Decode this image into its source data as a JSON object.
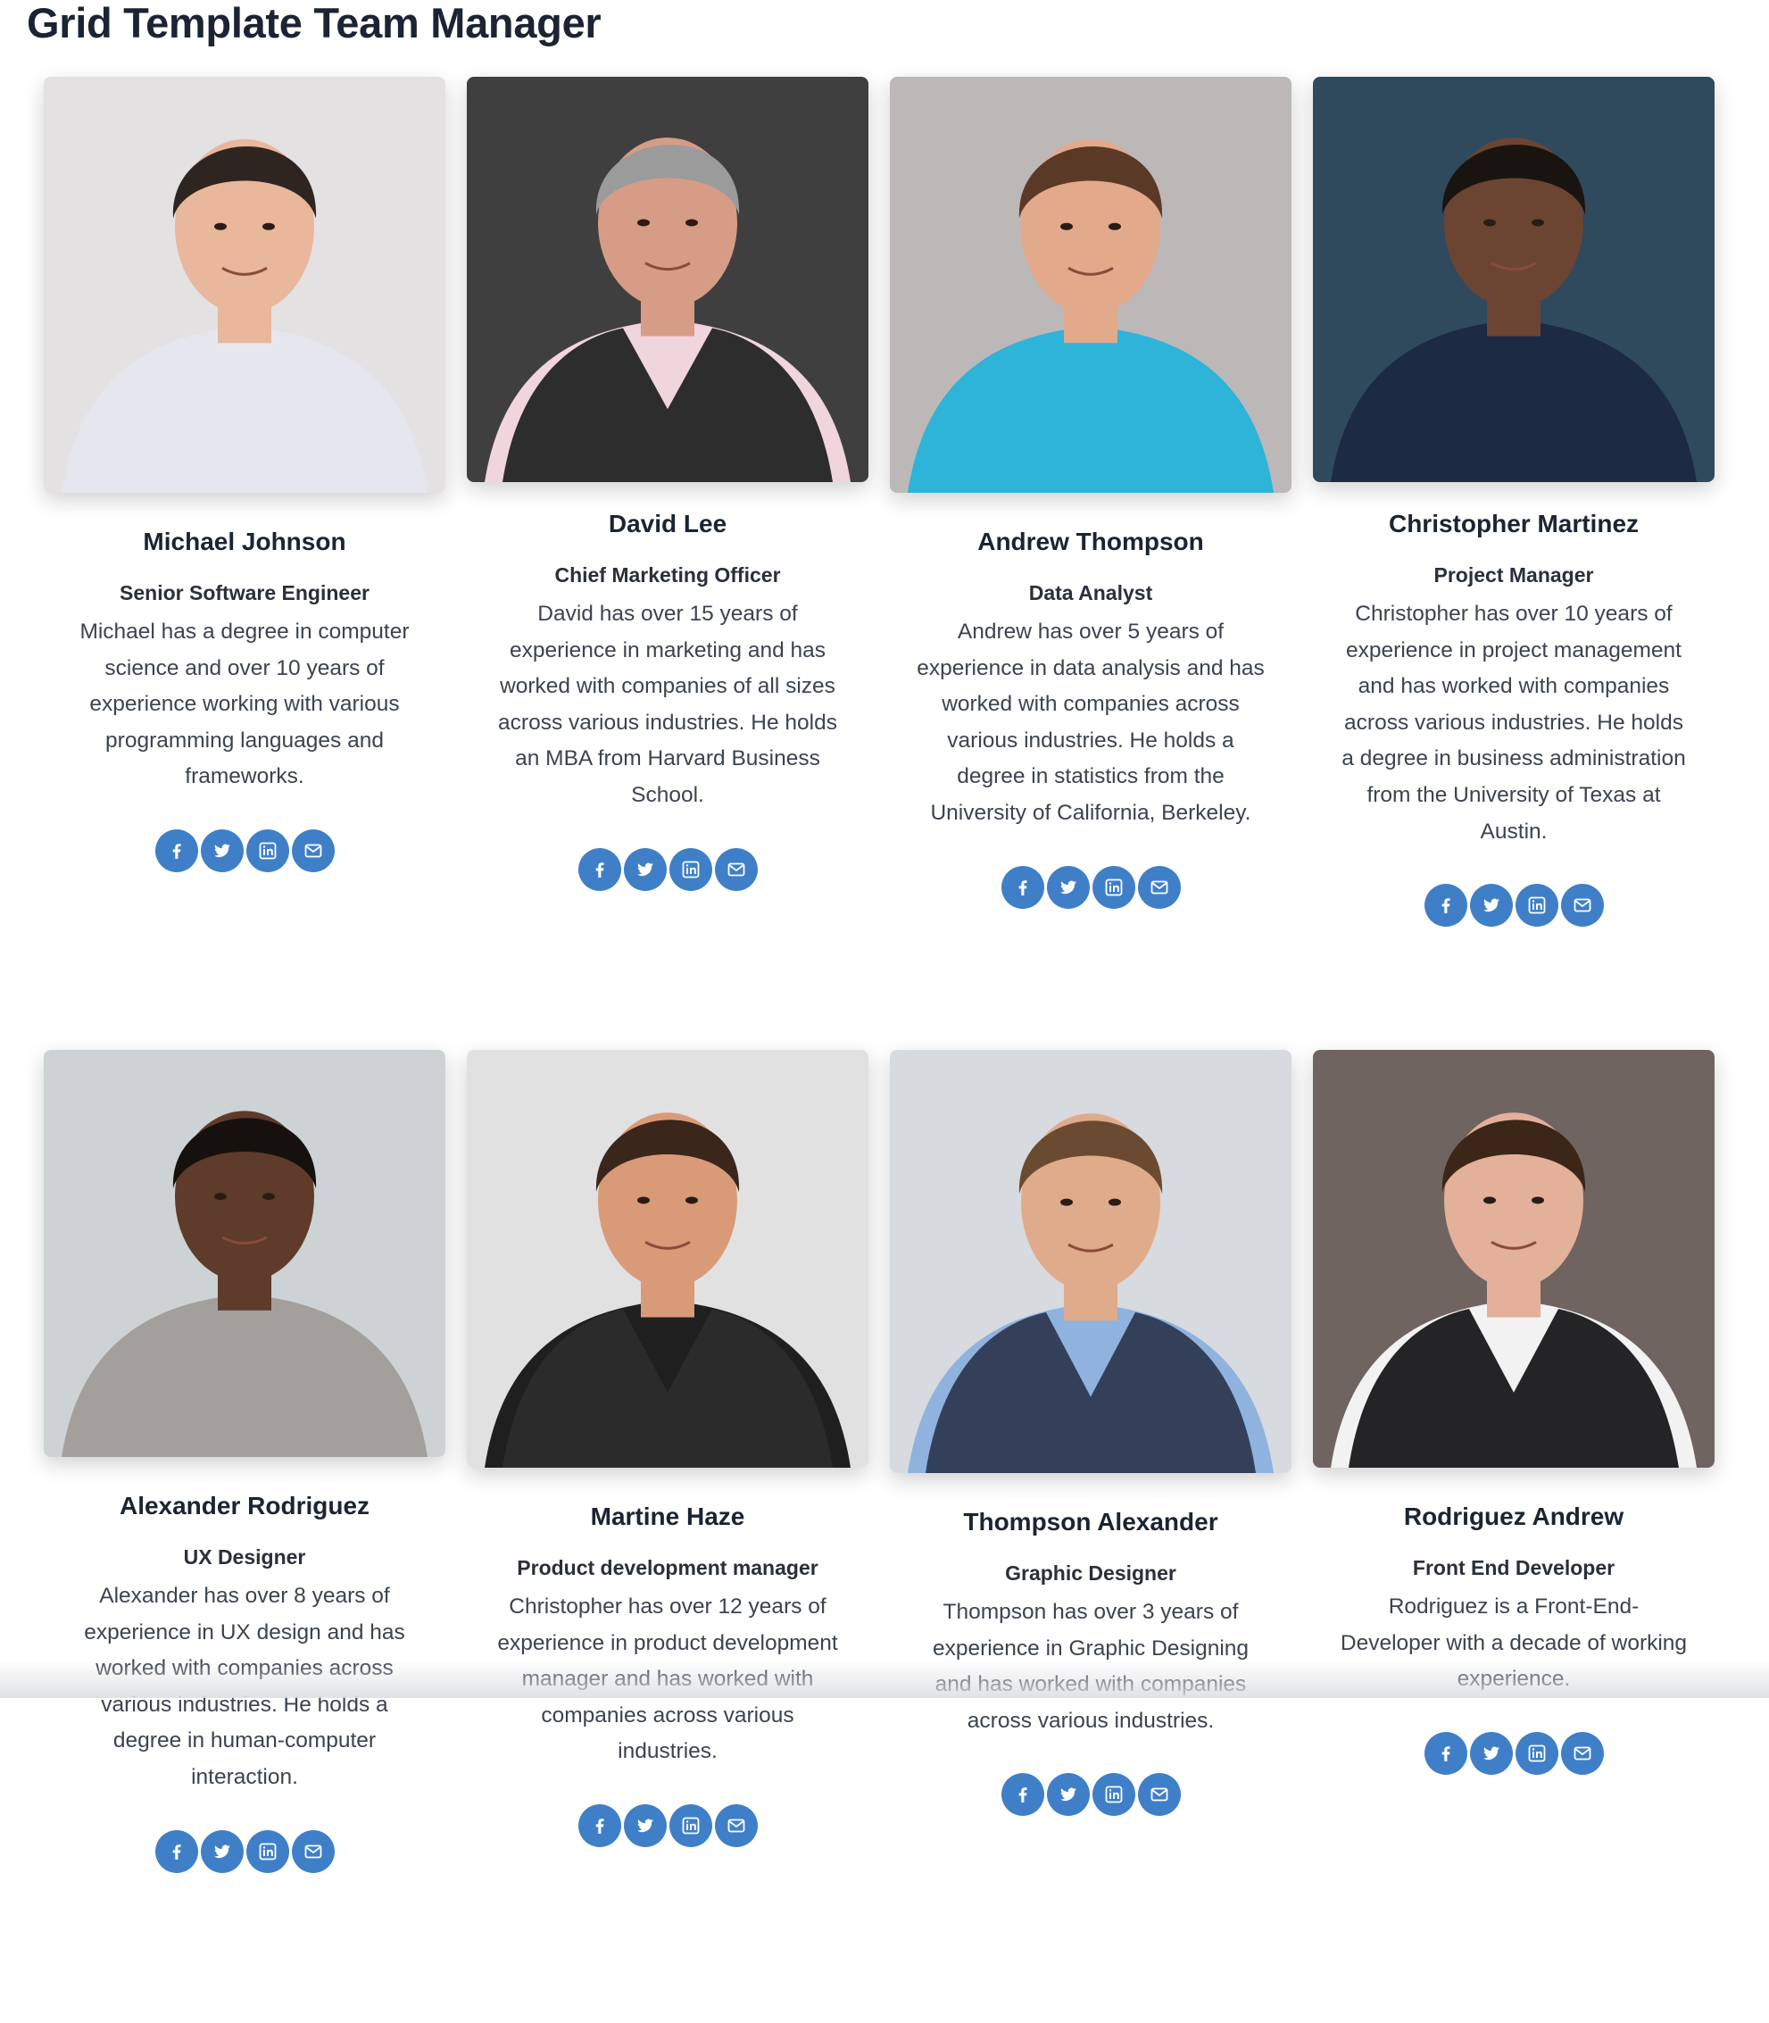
{
  "page": {
    "title": "Grid Template Team Manager"
  },
  "social_icons": [
    {
      "icon": "facebook-icon",
      "name": "facebook"
    },
    {
      "icon": "twitter-icon",
      "name": "twitter"
    },
    {
      "icon": "linkedin-icon",
      "name": "linkedin"
    },
    {
      "icon": "envelope-icon",
      "name": "email"
    }
  ],
  "colors": {
    "accent": "#3f7fc8",
    "title": "#1b2433",
    "text": "#3c4350"
  },
  "members": [
    {
      "name": "Michael Johnson",
      "role": "Senior Software Engineer",
      "bio": "Michael has a degree in computer science and over 10 years of experience working with various programming languages and frameworks.",
      "photo": {
        "bg": "#e3e1e2",
        "skin": "#e8b79c",
        "hair": "#2f2520",
        "shirt": "#e6e7ee",
        "jacket": ""
      }
    },
    {
      "name": "David Lee",
      "role": "Chief Marketing Officer",
      "bio": "David has over 15 years of experience in marketing and has worked with companies of all sizes across various industries. He holds an MBA from Harvard Business School.",
      "photo": {
        "bg": "#3f3f40",
        "skin": "#d79c86",
        "hair": "#9b9b9b",
        "shirt": "#f0d5dc",
        "jacket": "#2d2d2e"
      }
    },
    {
      "name": "Andrew Thompson",
      "role": "Data Analyst",
      "bio": "Andrew has over 5 years of experience in data analysis and has worked with companies across various industries. He holds a degree in statistics from the University of California, Berkeley.",
      "photo": {
        "bg": "#bcb8b8",
        "skin": "#e2a98a",
        "hair": "#5a3a26",
        "shirt": "#2eb3d9",
        "jacket": ""
      }
    },
    {
      "name": "Christopher Martinez",
      "role": "Project Manager",
      "bio": "Christopher has over 10 years of experience in project management and has worked with companies across various industries. He holds a degree in business administration from the University of Texas at Austin.",
      "photo": {
        "bg": "#2f4a5d",
        "skin": "#6b4532",
        "hair": "#1a1411",
        "shirt": "#1d2a44",
        "jacket": ""
      }
    },
    {
      "name": "Alexander Rodriguez",
      "role": "UX Designer",
      "bio": "Alexander has over 8 years of experience in UX design and has worked with companies across various industries. He holds a degree in human-computer interaction.",
      "photo": {
        "bg": "#cdd3d4",
        "skin": "#5e3b2a",
        "hair": "#17110e",
        "shirt": "#a3a09c",
        "jacket": ""
      }
    },
    {
      "name": "Martine Haze",
      "role": "Product development manager",
      "bio": "Christopher has over 12 years of experience in product development manager and has worked with companies across various industries.",
      "photo": {
        "bg": "#e2e1e1",
        "skin": "#d99a78",
        "hair": "#3a261b",
        "shirt": "#1f1f1f",
        "jacket": "#2b2b2c"
      }
    },
    {
      "name": "Thompson Alexander",
      "role": "Graphic Designer",
      "bio": "Thompson has over 3 years of experience in Graphic Designing and has worked with companies across various industries.",
      "photo": {
        "bg": "#d7dade",
        "skin": "#e0ab8a",
        "hair": "#6b4a32",
        "shirt": "#8fb3de",
        "jacket": "#34405a"
      }
    },
    {
      "name": "Rodriguez Andrew",
      "role": "Front End Developer",
      "bio": "Rodriguez is a Front-End-Developer with a decade of working experience.",
      "photo": {
        "bg": "#6f6460",
        "skin": "#e3b09a",
        "hair": "#3c2618",
        "shirt": "#f2f2f2",
        "jacket": "#242426"
      }
    }
  ]
}
